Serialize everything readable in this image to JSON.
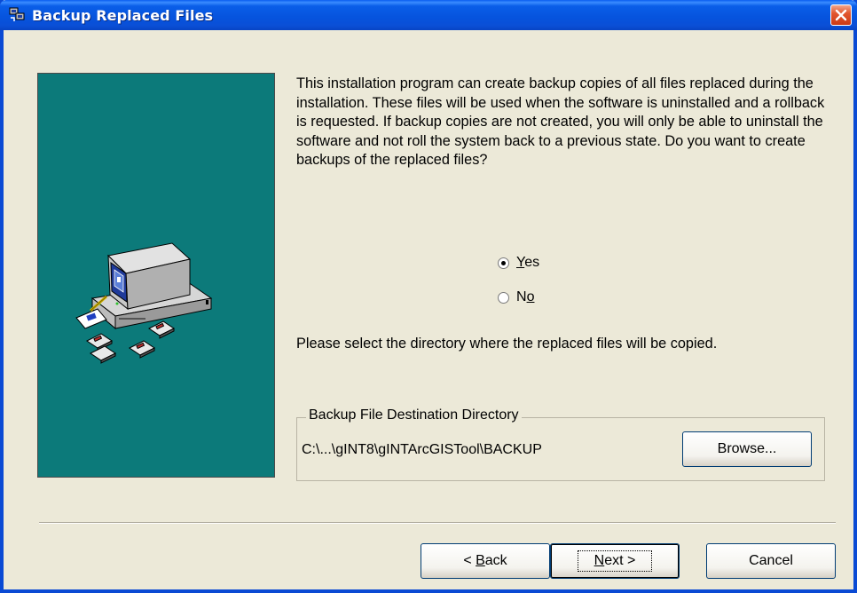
{
  "window": {
    "title": "Backup Replaced Files"
  },
  "icons": {
    "app": "setup-app-icon",
    "close": "close-icon",
    "illustration": "computer-with-floppy-disks"
  },
  "content": {
    "description": "This installation program can create backup copies of all files replaced during the installation. These files will be used when the software is uninstalled and a rollback is requested.  If backup copies are not created, you will only be able to uninstall the software and not roll the system back to a previous state.  Do you want to create backups of the replaced files?",
    "options": [
      {
        "label": "Yes",
        "mnemonic": "Y",
        "rest": "es",
        "checked": true
      },
      {
        "label": "No",
        "mnemonic_prefix": "N",
        "mnemonic": "o",
        "checked": false
      }
    ],
    "directory_prompt": "Please select the directory where the replaced  files will be copied."
  },
  "groupbox": {
    "legend": "Backup File Destination Directory",
    "path": "C:\\...\\gINT8\\gINTArcGISTool\\BACKUP",
    "browse_label": "Browse..."
  },
  "buttons": {
    "back": {
      "arrow": "<",
      "mnemonic": "B",
      "rest": "ack"
    },
    "next": {
      "mnemonic": "N",
      "rest": "ext",
      "arrow": ">"
    },
    "cancel": "Cancel"
  },
  "colors": {
    "titlebar": "#0a5ee8",
    "panel": "#0c7a7a",
    "dialog": "#ece9d8"
  }
}
